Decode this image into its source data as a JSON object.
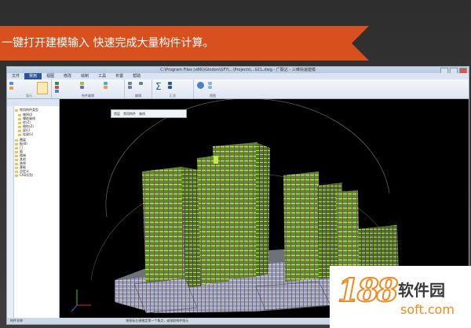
{
  "banner": {
    "text": "一键打开建模输入  快速完成大量构件计算。",
    "color": "#d9501f"
  },
  "app": {
    "title_path": "C:\\Program Files (x86)\\Glodon\\GFY\\...\\Projects\\...GCL.dwg - 广联达 - 三维快速建模",
    "menu": [
      "文件",
      "常用",
      "视图",
      "修改",
      "绘制",
      "工具",
      "布置",
      "帮助"
    ],
    "active_menu": "常用",
    "ribbon_groups": [
      "显示",
      "构件编辑",
      "编辑",
      "汇总",
      "视图"
    ],
    "float_toolbar": [
      "首层",
      "常用构件",
      "轴线"
    ],
    "tree": {
      "root": "常用构件类型",
      "items": [
        "轴网(J)",
        "辅助轴线",
        "柱(Z)",
        "暗柱(Z)",
        "梁(L)",
        "连梁(L)",
        "圈梁",
        "板(B)",
        "门",
        "窗",
        "楼梯",
        "其他",
        "装修",
        "基础",
        "自定义",
        "CAD识别"
      ]
    },
    "status_left": "构件名称",
    "bottom_text": "按鼠标左键指定第一个角点，或拾取构件图元"
  },
  "watermark": {
    "number": "188",
    "brand": "软件园",
    "url": "soft.com",
    "accent": "#f08a1e"
  }
}
